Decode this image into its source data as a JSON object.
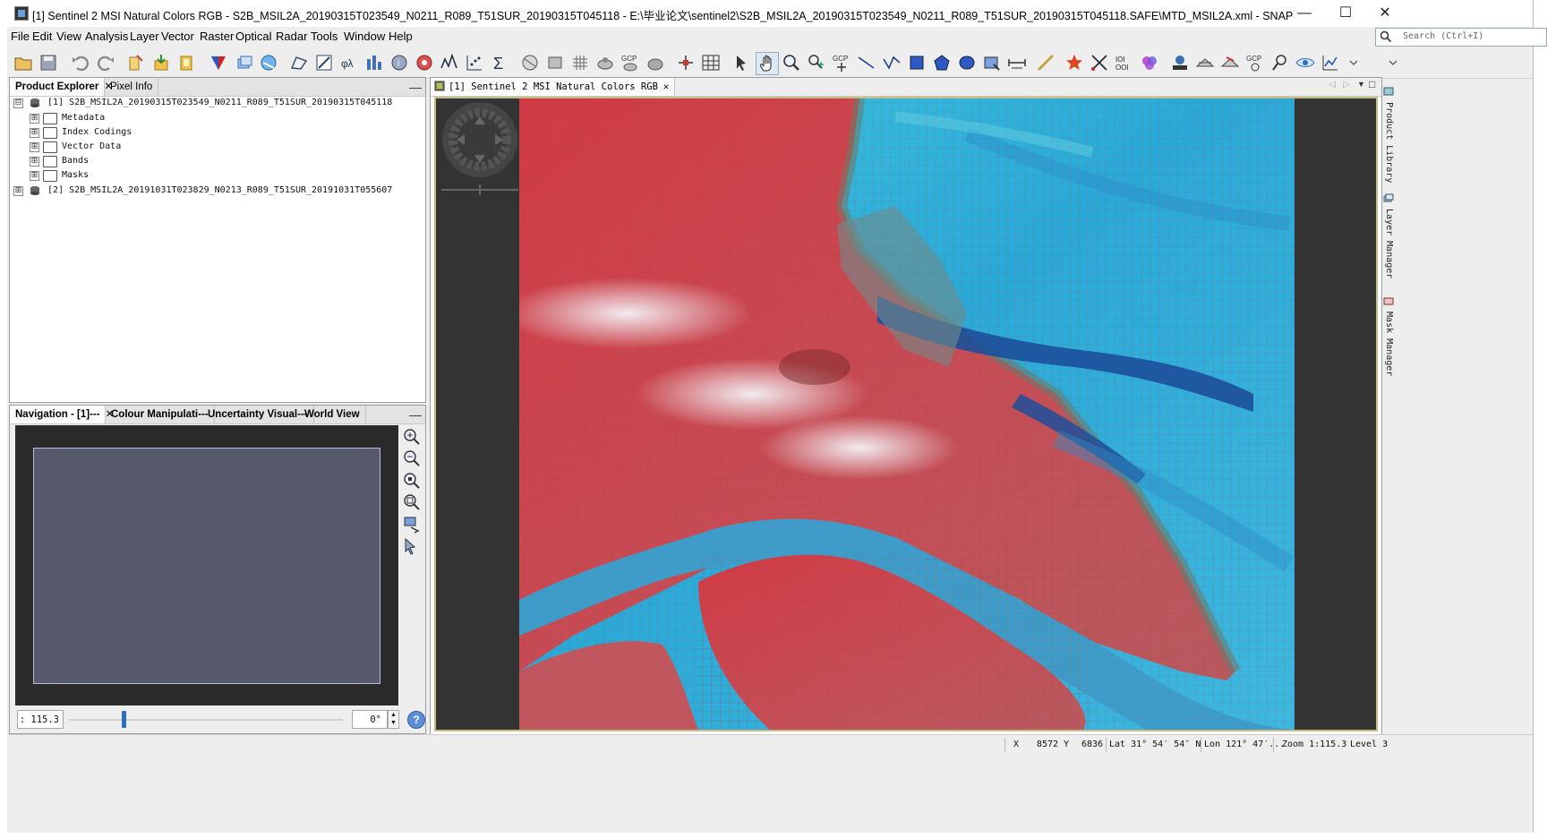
{
  "window": {
    "title": "[1] Sentinel 2 MSI Natural Colors RGB - S2B_MSIL2A_20190315T023549_N0211_R089_T51SUR_20190315T045118 - E:\\毕业论文\\sentinel2\\S2B_MSIL2A_20190315T023549_N0211_R089_T51SUR_20190315T045118.SAFE\\MTD_MSIL2A.xml - SNAP",
    "controls": {
      "minimize": "—",
      "maximize": "☐",
      "close": "✕"
    }
  },
  "menu": {
    "items": [
      "File",
      "Edit",
      "View",
      "Analysis",
      "Layer",
      "Vector",
      "Raster",
      "Optical",
      "Radar",
      "Tools",
      "Window",
      "Help"
    ]
  },
  "search": {
    "placeholder": "Search (Ctrl+I)",
    "icon": "search-icon"
  },
  "product_explorer": {
    "tabs": [
      {
        "label": "Product Explorer",
        "close": "✕"
      },
      {
        "label": "Pixel Info"
      }
    ],
    "minimize": "—",
    "products": [
      {
        "label": "[1]  S2B_MSIL2A_20190315T023549_N0211_R089_T51SUR_20190315T045118",
        "expanded": "⊟",
        "children": [
          "Metadata",
          "Index Codings",
          "Vector Data",
          "Bands",
          "Masks"
        ]
      },
      {
        "label": "[2]  S2B_MSIL2A_20191031T023829_N0213_R089_T51SUR_20191031T055607",
        "expanded": "⊞"
      }
    ],
    "collapsed_glyph": "⊞"
  },
  "navigation_panel": {
    "tabs": [
      {
        "label": "Navigation - [1]---",
        "close": "✕"
      },
      {
        "label": "Colour Manipulati---"
      },
      {
        "label": "Uncertainty Visual---"
      },
      {
        "label": "World View"
      }
    ],
    "minimize": "—",
    "scale_value": ": 115.3",
    "slider_position": 0.2,
    "angle_value": "0°",
    "spin_up": "▲",
    "spin_down": "▼",
    "help": "?"
  },
  "image_view": {
    "tab_label": "[1]  Sentinel 2 MSI Natural Colors RGB",
    "close": "✕",
    "right_controls": {
      "prev": "◁",
      "next": "▷",
      "menu": "▼",
      "maximize": "□"
    }
  },
  "side_tabs": [
    "Product Library",
    "Layer Manager",
    "Mask Manager"
  ],
  "status": {
    "x_label": "X",
    "x_value": "8572",
    "y_label": "Y",
    "y_value": "6836",
    "lat": "Lat 31° 54′ 54″ N",
    "lon": "Lon 121° 47′...",
    "zoom": "Zoom 1:115.3",
    "level": "Level 3"
  },
  "colors": {
    "accent": "#2b6fc1",
    "vegetation_red": "#d43a43",
    "water_cyan": "#2fb7d8",
    "deep_water": "#1d4f9a",
    "canvas_bg": "#333333",
    "canvas_border": "#c9bd86"
  }
}
